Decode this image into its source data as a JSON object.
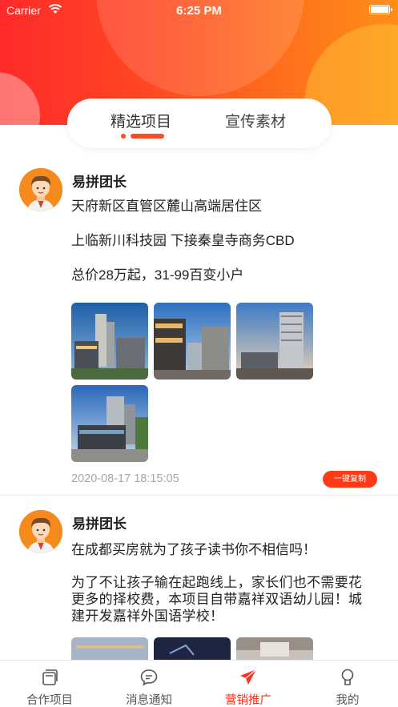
{
  "status_bar": {
    "carrier": "Carrier",
    "time": "6:25 PM"
  },
  "tabs": [
    {
      "label": "精选项目",
      "active": true
    },
    {
      "label": "宣传素材",
      "active": false
    }
  ],
  "posts": [
    {
      "author": "易拼团长",
      "lines": [
        "天府新区直管区麓山高端居住区",
        "上临新川科技园 下接秦皇寺商务CBD",
        "总价28万起，31-99百变小户"
      ],
      "time": "2020-08-17 18:15:05",
      "copy_label": "一键复制"
    },
    {
      "author": "易拼团长",
      "lines": [
        "在成都买房就为了孩子读书你不相信吗！",
        "为了不让孩子输在起跑线上，家长们也不需要花更多的择校费，本项目自带嘉祥双语幼儿园！城建开发嘉祥外国语学校！"
      ]
    }
  ],
  "bottom_nav": [
    {
      "label": "合作项目",
      "icon": "cards-icon",
      "active": false
    },
    {
      "label": "消息通知",
      "icon": "chat-bubble-icon",
      "active": false
    },
    {
      "label": "营销推广",
      "icon": "paper-plane-icon",
      "active": true
    },
    {
      "label": "我的",
      "icon": "user-icon",
      "active": false
    }
  ],
  "colors": {
    "accent": "#ff2f1a",
    "header_start": "#ff2a2a",
    "header_end": "#ff8f17",
    "avatar_bg": "#f78a1d"
  }
}
